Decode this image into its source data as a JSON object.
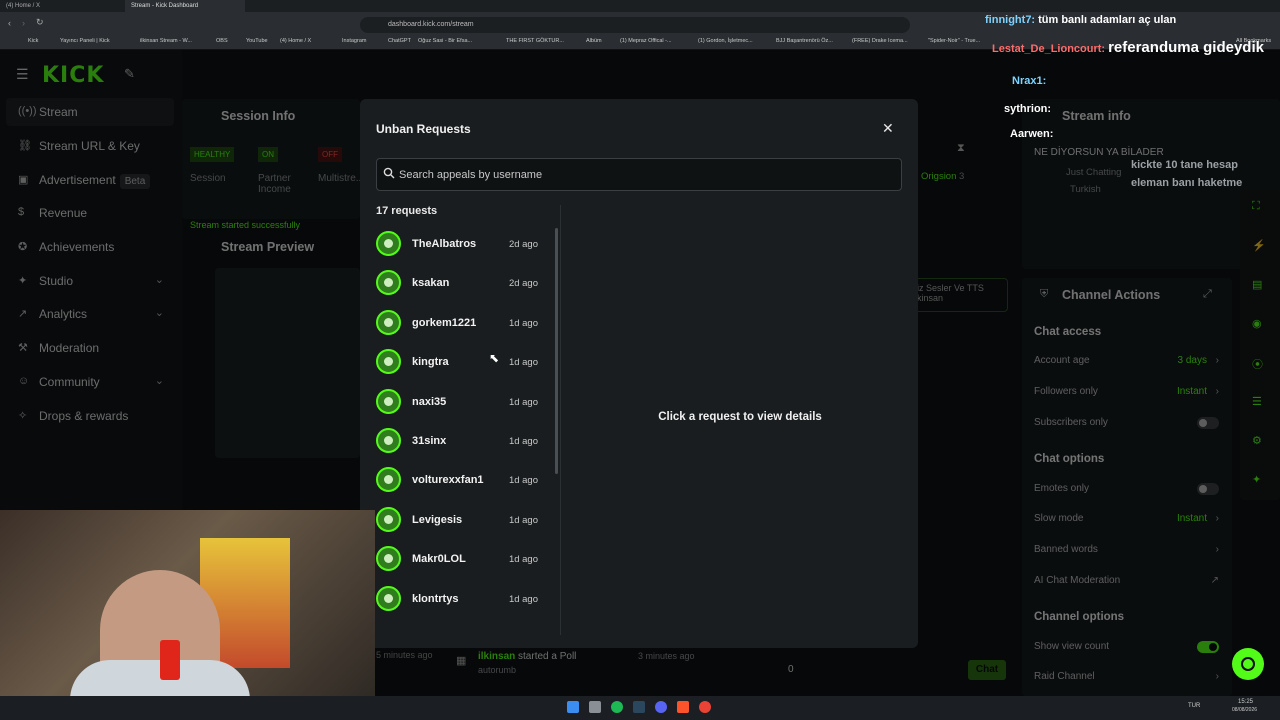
{
  "browser": {
    "tabs": [
      "(4) Home / X",
      "Stream - Kick Dashboard"
    ],
    "url": "dashboard.kick.com/stream",
    "bookmarks": [
      "Kick",
      "Yayıncı Paneli | Kick",
      "ilkinsan Stream - W...",
      "OBS",
      "YouTube",
      "(4) Home / X",
      "Instagram",
      "ChatGPT",
      "Oğuz Sasi - Bir Efsa...",
      "THE FIRST GÖKTUR...",
      "Albüm",
      "(1) Mepraz Offical -...",
      "(1) Gordon, İşletmec...",
      "BJJ Başantrenörü Öz...",
      "(FREE) Drake Icema...",
      "\"Spider-Noir\" - True...",
      "All Bookmarks"
    ]
  },
  "sidebar": {
    "logo": "KICK",
    "items": [
      {
        "label": "Stream",
        "icon": "broadcast-icon",
        "glyph": "((•))"
      },
      {
        "label": "Stream URL & Key",
        "icon": "link-icon",
        "glyph": "⛓"
      },
      {
        "label": "Advertisement",
        "icon": "megaphone-icon",
        "glyph": "▣",
        "badge": "Beta"
      },
      {
        "label": "Revenue",
        "icon": "dollar-icon",
        "glyph": "$"
      },
      {
        "label": "Achievements",
        "icon": "trophy-icon",
        "glyph": "✪"
      },
      {
        "label": "Studio",
        "icon": "studio-icon",
        "glyph": "✦"
      },
      {
        "label": "Analytics",
        "icon": "chart-icon",
        "glyph": "↗"
      },
      {
        "label": "Moderation",
        "icon": "hammer-icon",
        "glyph": "⚒"
      },
      {
        "label": "Community",
        "icon": "users-icon",
        "glyph": "☺"
      },
      {
        "label": "Drops & rewards",
        "icon": "gift-icon",
        "glyph": "✧"
      }
    ]
  },
  "session": {
    "title": "Session Info",
    "badges": [
      "HEALTHY",
      "ON",
      "OFF"
    ],
    "labels": [
      "Session",
      "Partner Income",
      "Multistre..."
    ],
    "notice": "Stream started successfully"
  },
  "preview": {
    "title": "Stream Preview"
  },
  "stream_info": {
    "title": "Stream info",
    "stream_title": "NE DİYORSUN YA BİLADER",
    "category": "Just Chatting",
    "language": "Turkish",
    "tag": "Origsion",
    "tag_count": "3",
    "alerts_hint": "iz Sesler Ve TTS",
    "alerts_name": "kinsan"
  },
  "channel_actions": {
    "title": "Channel Actions",
    "sections": [
      {
        "heading": "Chat access",
        "items": [
          {
            "label": "Account age",
            "value": "3 days",
            "type": "link"
          },
          {
            "label": "Followers only",
            "value": "Instant",
            "type": "link"
          },
          {
            "label": "Subscribers only",
            "value": "",
            "type": "toggle-off"
          }
        ]
      },
      {
        "heading": "Chat options",
        "items": [
          {
            "label": "Emotes only",
            "value": "",
            "type": "toggle-off"
          },
          {
            "label": "Slow mode",
            "value": "Instant",
            "type": "link"
          },
          {
            "label": "Banned words",
            "value": "",
            "type": "link"
          },
          {
            "label": "AI Chat Moderation",
            "value": "",
            "type": "external"
          }
        ]
      },
      {
        "heading": "Channel options",
        "items": [
          {
            "label": "Show view count",
            "value": "",
            "type": "toggle-on"
          },
          {
            "label": "Raid Channel",
            "value": "",
            "type": "link"
          }
        ]
      }
    ]
  },
  "activity": {
    "user": "ilkinsan",
    "action": "started a Poll",
    "time": "3 minutes ago",
    "time_left": "5 minutes ago",
    "sub": "autorumb",
    "viewers": "0",
    "chat_button": "Chat"
  },
  "modal": {
    "title": "Unban Requests",
    "search_placeholder": "Search appeals by username",
    "count_label": "17 requests",
    "empty_text": "Click a request to view details",
    "requests": [
      {
        "username": "TheAlbatros",
        "ago": "2d ago"
      },
      {
        "username": "ksakan",
        "ago": "2d ago"
      },
      {
        "username": "gorkem1221",
        "ago": "1d ago"
      },
      {
        "username": "kingtra",
        "ago": "1d ago"
      },
      {
        "username": "naxi35",
        "ago": "1d ago"
      },
      {
        "username": "31sinx",
        "ago": "1d ago"
      },
      {
        "username": "volturexxfan1",
        "ago": "1d ago"
      },
      {
        "username": "Levigesis",
        "ago": "1d ago"
      },
      {
        "username": "Makr0LOL",
        "ago": "1d ago"
      },
      {
        "username": "klontrtys",
        "ago": "1d ago"
      }
    ]
  },
  "overlay_chat": [
    {
      "user": "finnight7:",
      "msg": "tüm banlı adamları aç ulan"
    },
    {
      "user": "Lestat_De_Lioncourt:",
      "msg": "referanduma gideydik"
    },
    {
      "user": "Nrax1:",
      "msg": ""
    },
    {
      "user": "sythrion:",
      "msg": ""
    },
    {
      "user": "Aarwen:",
      "msg": ""
    },
    {
      "user": "",
      "msg": "kickte 10 tane hesap"
    },
    {
      "user": "",
      "msg": "eleman banı haketme"
    }
  ],
  "taskbar": {
    "lang": "TUR",
    "time": "15:25",
    "date": "08/08/2026"
  },
  "colors": {
    "accent": "#53fc18",
    "modal_bg": "#191d1f",
    "page_bg": "#0b0e0f"
  }
}
